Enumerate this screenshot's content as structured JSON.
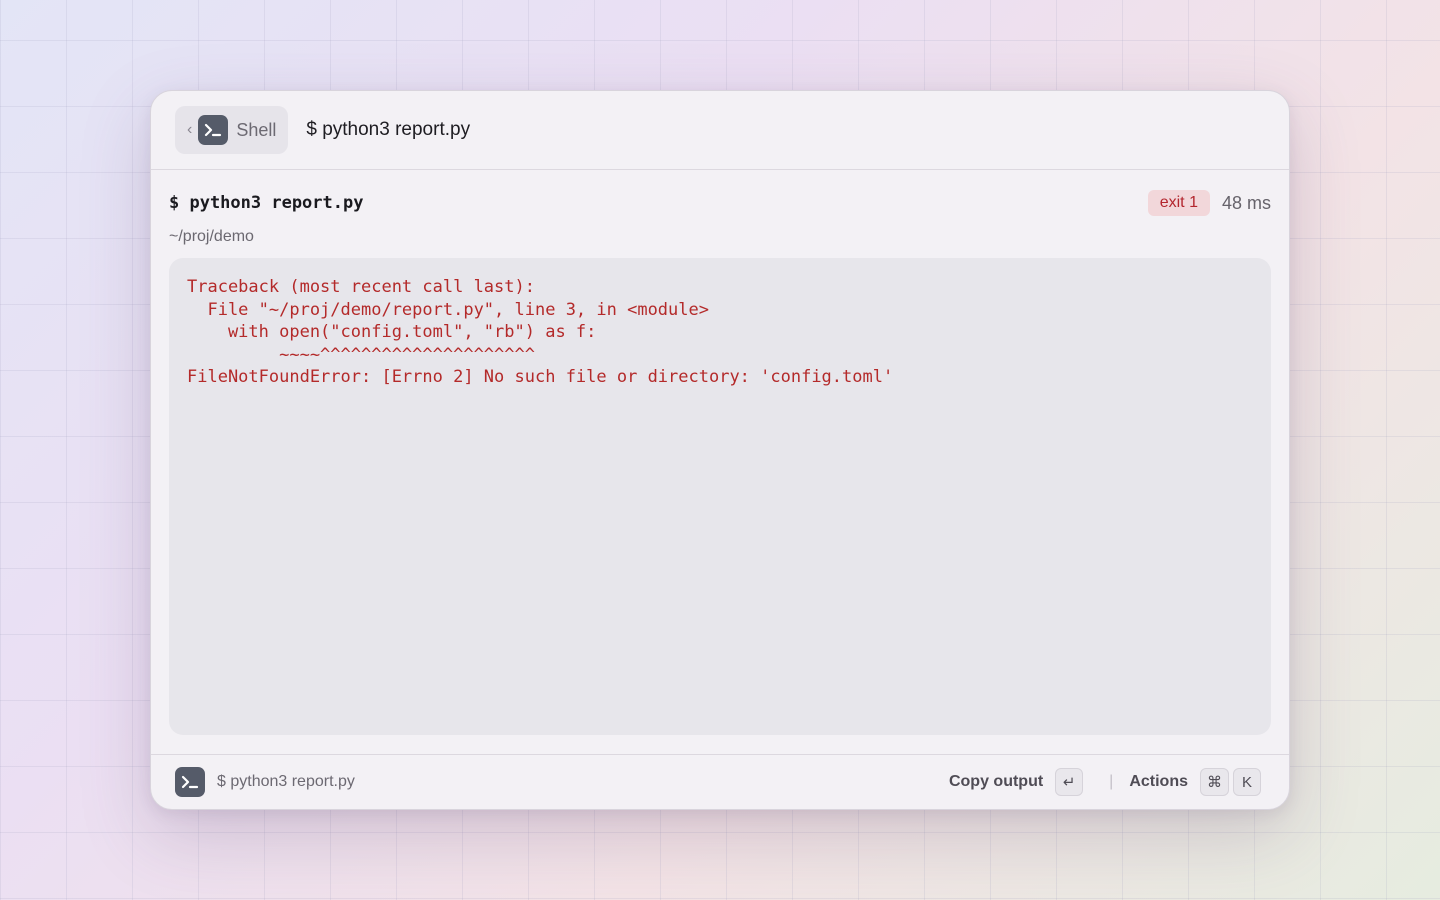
{
  "titlebar": {
    "back_label": "Shell",
    "title": "$ python3 report.py"
  },
  "command": {
    "text": "$ python3 report.py",
    "exit_badge": "exit 1",
    "duration": "48 ms",
    "cwd": "~/proj/demo"
  },
  "output": {
    "text": "Traceback (most recent call last):\n  File \"~/proj/demo/report.py\", line 3, in <module>\n    with open(\"config.toml\", \"rb\") as f:\n         ~~~~^^^^^^^^^^^^^^^^^^^^^\nFileNotFoundError: [Errno 2] No such file or directory: 'config.toml'"
  },
  "footer": {
    "command": "$ python3 report.py",
    "copy_label": "Copy output",
    "copy_key": "↵",
    "actions_label": "Actions",
    "actions_keys": [
      "⌘",
      "K"
    ]
  },
  "colors": {
    "error_text": "#b42a2a",
    "exit_badge_bg": "#f2d7da",
    "icon_bg": "#555b69"
  },
  "icons": {
    "chevron": "chevron-left-icon",
    "terminal": "terminal-icon"
  }
}
